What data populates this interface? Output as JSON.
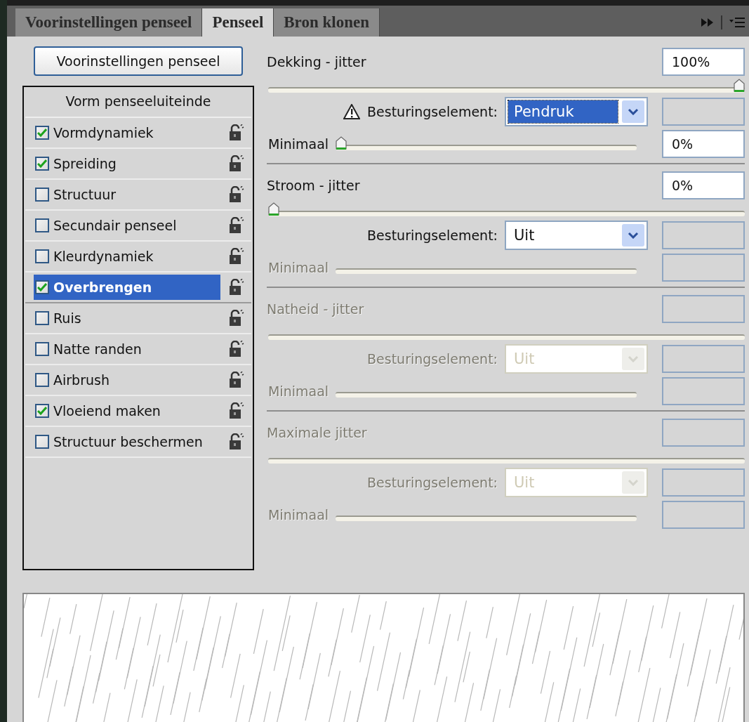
{
  "tabs": [
    {
      "label": "Voorinstellingen penseel",
      "selected": false
    },
    {
      "label": "Penseel",
      "selected": true
    },
    {
      "label": "Bron klonen",
      "selected": false
    }
  ],
  "preset_button": "Voorinstellingen penseel",
  "brush_options": {
    "header": "Vorm penseeluiteinde",
    "items": [
      {
        "label": "Vormdynamiek",
        "checked": true,
        "selected": false
      },
      {
        "label": "Spreiding",
        "checked": true,
        "selected": false
      },
      {
        "label": "Structuur",
        "checked": false,
        "selected": false
      },
      {
        "label": "Secundair penseel",
        "checked": false,
        "selected": false
      },
      {
        "label": "Kleurdynamiek",
        "checked": false,
        "selected": false
      },
      {
        "label": "Overbrengen",
        "checked": true,
        "selected": true
      },
      {
        "label": "Ruis",
        "checked": false,
        "selected": false
      },
      {
        "label": "Natte randen",
        "checked": false,
        "selected": false
      },
      {
        "label": "Airbrush",
        "checked": false,
        "selected": false
      },
      {
        "label": "Vloeiend maken",
        "checked": true,
        "selected": false
      },
      {
        "label": "Structuur beschermen",
        "checked": false,
        "selected": false
      }
    ]
  },
  "sections": [
    {
      "title": "Dekking - jitter",
      "value": "100%",
      "level": 1,
      "disabled": false,
      "control": {
        "label": "Besturingselement:",
        "value": "Pendruk",
        "warning": true,
        "highlighted": true,
        "disabled": false
      },
      "minimum": {
        "label": "Minimaal",
        "value": "0%",
        "level": 0,
        "disabled": false
      }
    },
    {
      "title": "Stroom - jitter",
      "value": "0%",
      "level": 0,
      "disabled": false,
      "control": {
        "label": "Besturingselement:",
        "value": "Uit",
        "warning": false,
        "highlighted": false,
        "disabled": false
      },
      "minimum": {
        "label": "Minimaal",
        "disabled": true
      }
    },
    {
      "title": "Natheid - jitter",
      "disabled": true,
      "control": {
        "label": "Besturingselement:",
        "value": "Uit",
        "warning": false,
        "highlighted": false,
        "disabled": true
      },
      "minimum": {
        "label": "Minimaal",
        "disabled": true
      }
    },
    {
      "title": "Maximale jitter",
      "disabled": true,
      "control": {
        "label": "Besturingselement:",
        "value": "Uit",
        "warning": false,
        "highlighted": false,
        "disabled": true
      },
      "minimum": {
        "label": "Minimaal",
        "disabled": true
      }
    }
  ]
}
